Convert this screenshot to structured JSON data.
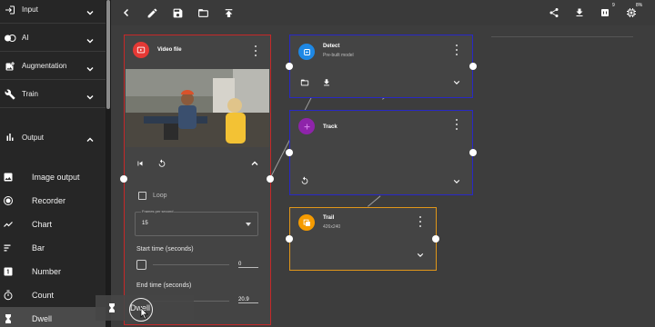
{
  "sidebar": {
    "sections": [
      {
        "label": "Input",
        "icon": "login-icon",
        "expanded": false
      },
      {
        "label": "AI",
        "icon": "ai-icon",
        "expanded": false
      },
      {
        "label": "Augmentation",
        "icon": "augmentation-icon",
        "expanded": false
      },
      {
        "label": "Train",
        "icon": "wrench-icon",
        "expanded": false
      },
      {
        "label": "Output",
        "icon": "bar-chart-icon",
        "expanded": true
      }
    ],
    "output_items": [
      {
        "label": "Image output",
        "icon": "image-icon"
      },
      {
        "label": "Recorder",
        "icon": "record-icon"
      },
      {
        "label": "Chart",
        "icon": "line-chart-icon"
      },
      {
        "label": "Bar",
        "icon": "bars-icon"
      },
      {
        "label": "Number",
        "icon": "number-one-icon"
      },
      {
        "label": "Count",
        "icon": "stopwatch-icon"
      },
      {
        "label": "Dwell",
        "icon": "hourglass-icon"
      }
    ],
    "active_item": "Dwell"
  },
  "toolbar": {
    "left_icons": [
      "back-icon",
      "pencil-icon",
      "save-icon",
      "folder-icon",
      "upload-icon"
    ],
    "right_icons": [
      "share-icon",
      "download-icon",
      "memory-icon",
      "cpu-icon"
    ],
    "memory_badge": "9",
    "cpu_badge": "8%"
  },
  "nodes": {
    "video": {
      "title": "Video file",
      "color": "#e53935",
      "loop_label": "Loop",
      "fps_legend": "Frames per second",
      "fps_value": "15",
      "start_label": "Start time (seconds)",
      "start_value": "0",
      "end_label": "End time (seconds)",
      "end_value": "20.9"
    },
    "detect": {
      "title": "Detect",
      "subtitle": "Pre-built model",
      "color": "#1e88e5"
    },
    "track": {
      "title": "Track",
      "color": "#8e24aa"
    },
    "trail": {
      "title": "Trail",
      "subtitle": "426x240",
      "color": "#f59b00"
    }
  },
  "drag_ghost": {
    "label": "Dwell"
  },
  "colors": {
    "video_border": "#c62828",
    "detect_border": "#2828c6",
    "track_border": "#2828c6",
    "trail_border": "#e0961a"
  }
}
